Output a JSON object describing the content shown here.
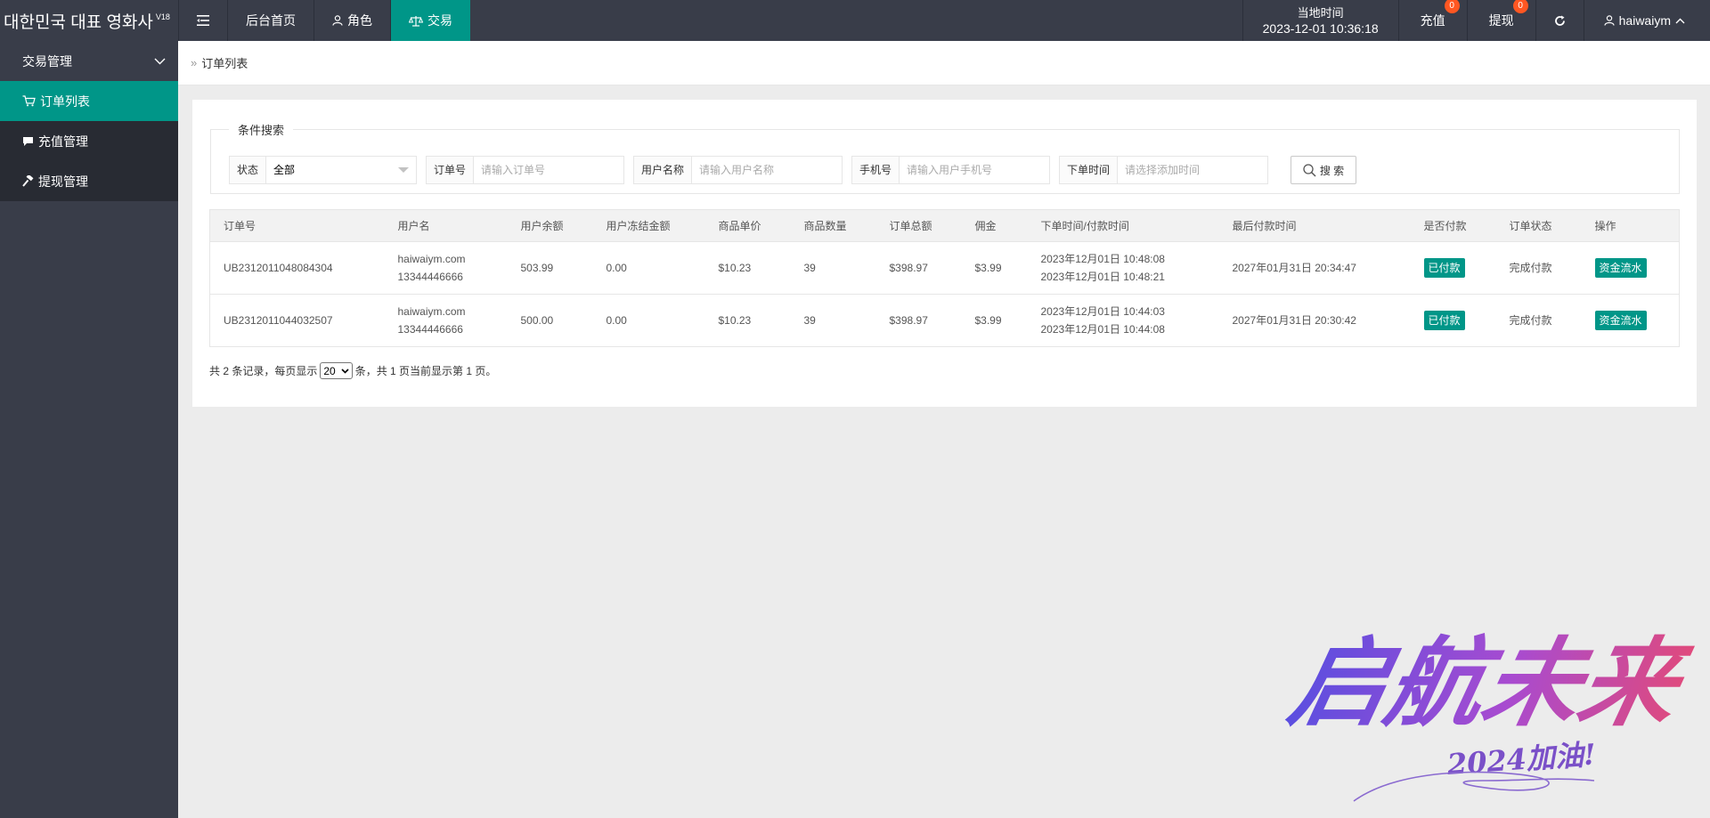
{
  "header": {
    "brand": "대한민국 대표 영화사",
    "brand_version": "V18",
    "nav": [
      {
        "label": "后台首页"
      },
      {
        "label": "角色"
      },
      {
        "label": "交易"
      }
    ],
    "time_label": "当地时间",
    "time_value": "2023-12-01 10:36:18",
    "recharge_label": "充值",
    "recharge_count": "0",
    "withdraw_label": "提现",
    "withdraw_count": "0",
    "username": "haiwaiym"
  },
  "sidebar": {
    "group_label": "交易管理",
    "items": [
      {
        "label": "订单列表",
        "icon": "cart-icon"
      },
      {
        "label": "充值管理",
        "icon": "comment-icon"
      },
      {
        "label": "提现管理",
        "icon": "hammer-icon"
      }
    ]
  },
  "breadcrumb": {
    "current": "订单列表"
  },
  "search": {
    "legend": "条件搜索",
    "status_label": "状态",
    "status_value": "全部",
    "order_label": "订单号",
    "order_placeholder": "请输入订单号",
    "user_label": "用户名称",
    "user_placeholder": "请输入用户名称",
    "phone_label": "手机号",
    "phone_placeholder": "请输入用户手机号",
    "time_label": "下单时间",
    "time_placeholder": "请选择添加时间",
    "button_label": "搜 索"
  },
  "table": {
    "headers": [
      "订单号",
      "用户名",
      "用户余额",
      "用户冻结金额",
      "商品单价",
      "商品数量",
      "订单总额",
      "佣金",
      "下单时间/付款时间",
      "最后付款时间",
      "是否付款",
      "订单状态",
      "操作"
    ],
    "rows": [
      {
        "order_no": "UB2312011048084304",
        "user_name": "haiwaiym.com",
        "user_phone": "13344446666",
        "balance": "503.99",
        "frozen": "0.00",
        "unit_price": "$10.23",
        "quantity": "39",
        "total": "$398.97",
        "commission": "$3.99",
        "order_time": "2023年12月01日 10:48:08",
        "pay_time": "2023年12月01日 10:48:21",
        "last_pay_time": "2027年01月31日 20:34:47",
        "paid": "已付款",
        "status": "完成付款",
        "action": "资金流水"
      },
      {
        "order_no": "UB2312011044032507",
        "user_name": "haiwaiym.com",
        "user_phone": "13344446666",
        "balance": "500.00",
        "frozen": "0.00",
        "unit_price": "$10.23",
        "quantity": "39",
        "total": "$398.97",
        "commission": "$3.99",
        "order_time": "2023年12月01日 10:44:03",
        "pay_time": "2023年12月01日 10:44:08",
        "last_pay_time": "2027年01月31日 20:30:42",
        "paid": "已付款",
        "status": "完成付款",
        "action": "资金流水"
      }
    ]
  },
  "pager": {
    "prefix": "共 2 条记录，每页显示",
    "page_size": "20",
    "suffix": "条，共 1 页当前显示第 1 页。"
  },
  "watermark": {
    "main": "启航未来",
    "sub": "2024加油!"
  },
  "colors": {
    "header_bg": "#393d49",
    "accent": "#009688",
    "badge": "#ff5722"
  }
}
